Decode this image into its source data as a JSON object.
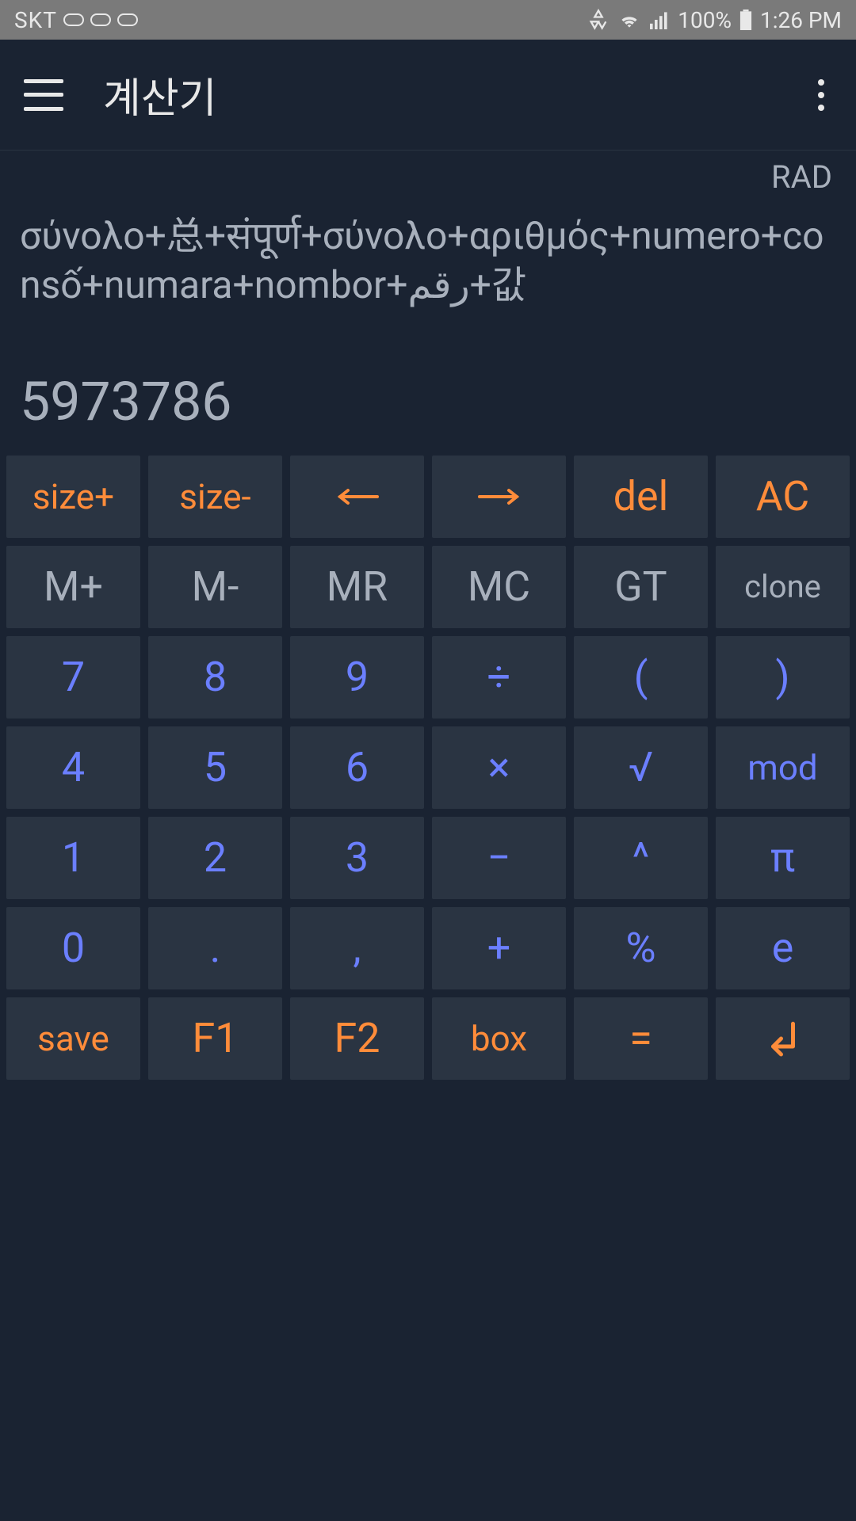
{
  "statusBar": {
    "carrier": "SKT",
    "battery": "100%",
    "time": "1:26 PM"
  },
  "appBar": {
    "title": "계산기"
  },
  "display": {
    "mode": "RAD",
    "expression": "σύνολο+总+संपूर्ण+σύνολο+αριθμός+numero+consố+numara+nombor+رقم+값",
    "result": "5973786"
  },
  "keys": {
    "row1": {
      "sizePlus": "size+",
      "sizeMinus": "size-",
      "left": "←",
      "right": "→",
      "del": "del",
      "ac": "AC"
    },
    "row2": {
      "mPlus": "M+",
      "mMinus": "M-",
      "mr": "MR",
      "mc": "MC",
      "gt": "GT",
      "clone": "clone"
    },
    "row3": {
      "seven": "7",
      "eight": "8",
      "nine": "9",
      "divide": "÷",
      "lparen": "(",
      "rparen": ")"
    },
    "row4": {
      "four": "4",
      "five": "5",
      "six": "6",
      "multiply": "×",
      "sqrt": "√",
      "mod": "mod"
    },
    "row5": {
      "one": "1",
      "two": "2",
      "three": "3",
      "minus": "−",
      "power": "^",
      "pi": "π"
    },
    "row6": {
      "zero": "0",
      "dot": ".",
      "comma": ",",
      "plus": "+",
      "percent": "%",
      "e": "e"
    },
    "row7": {
      "save": "save",
      "f1": "F1",
      "f2": "F2",
      "box": "box",
      "equals": "=",
      "enter": "↵"
    }
  }
}
